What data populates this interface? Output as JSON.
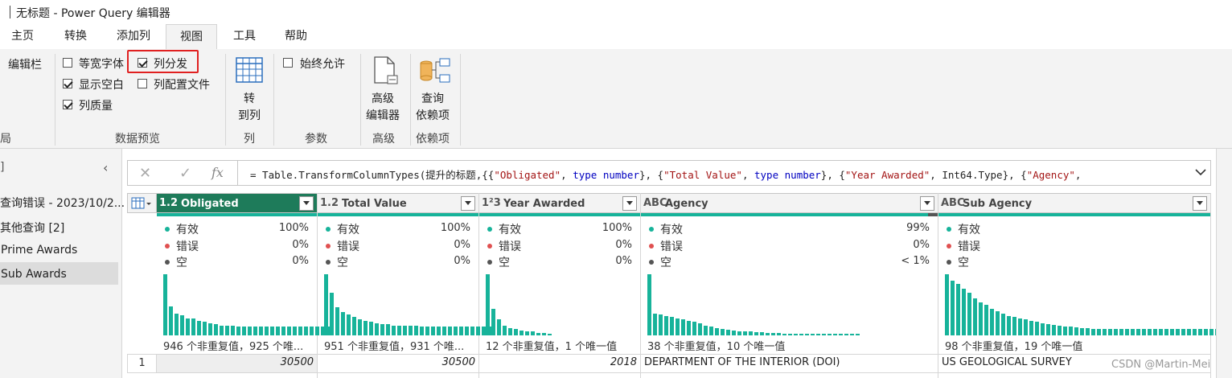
{
  "window": {
    "title": "无标题 - Power Query 编辑器"
  },
  "tabs": [
    "主页",
    "转换",
    "添加列",
    "视图",
    "工具",
    "帮助"
  ],
  "active_tab": "视图",
  "ribbon": {
    "layout_group": {
      "item": "编辑栏",
      "label": "局"
    },
    "preview_group": {
      "label": "数据预览",
      "items": [
        {
          "label": "等宽字体",
          "checked": false
        },
        {
          "label": "列分发",
          "checked": true
        },
        {
          "label": "显示空白",
          "checked": true
        },
        {
          "label": "列配置文件",
          "checked": false
        },
        {
          "label": "列质量",
          "checked": true
        }
      ]
    },
    "columns_group": {
      "label": "列",
      "button_line1": "转",
      "button_line2": "到列"
    },
    "params_group": {
      "label": "参数",
      "item": "始终允许",
      "checked": false
    },
    "advanced_group": {
      "label": "高级",
      "button_line1": "高级",
      "button_line2": "编辑器"
    },
    "deps_group": {
      "label": "依赖项",
      "button_line1": "查询",
      "button_line2": "依赖项"
    }
  },
  "left_panel": {
    "header": "]",
    "items": [
      "查询错误 - 2023/10/2...",
      "其他查询 [2]",
      "Prime Awards",
      "Sub Awards"
    ],
    "selected": "Sub Awards"
  },
  "formula": {
    "prefix": "= Table.TransformColumnTypes(提升的标题,{{",
    "s1": "\"Obligated\"",
    "t1": "type",
    "n1": "number",
    "s2": "\"Total Value\"",
    "t2": "type",
    "n2": "number",
    "s3": "\"Year Awarded\"",
    "t3": "Int64.Type",
    "s4": "\"Agency\"",
    "fx": "fx"
  },
  "quality_labels": {
    "valid": "有效",
    "error": "错误",
    "empty": "空"
  },
  "columns": [
    {
      "type": "1.2",
      "name": "Obligated",
      "valid": "100%",
      "error": "0%",
      "empty": "0%",
      "dist": "946 个非重复值，925 个唯...",
      "cell": "30500",
      "bars": [
        100,
        48,
        36,
        33,
        28,
        28,
        24,
        22,
        20,
        18,
        16,
        16,
        16,
        14,
        14,
        14,
        14,
        14,
        14,
        14,
        14,
        14,
        14,
        14,
        14,
        14,
        14,
        14,
        14,
        14
      ]
    },
    {
      "type": "1.2",
      "name": "Total Value",
      "valid": "100%",
      "error": "0%",
      "empty": "0%",
      "dist": "951 个非重复值，931 个唯...",
      "cell": "30500",
      "bars": [
        100,
        70,
        46,
        38,
        34,
        30,
        26,
        24,
        22,
        20,
        18,
        18,
        16,
        16,
        16,
        16,
        16,
        14,
        14,
        14,
        14,
        14,
        14,
        14,
        14,
        14,
        14,
        14,
        14,
        14
      ]
    },
    {
      "type": "1²3",
      "name": "Year Awarded",
      "valid": "100%",
      "error": "0%",
      "empty": "0%",
      "dist": "12 个非重复值，1 个唯一值",
      "cell": "2018",
      "bars": [
        100,
        44,
        26,
        16,
        12,
        10,
        8,
        6,
        6,
        4,
        4,
        2
      ]
    },
    {
      "type": "ABC",
      "name": "Agency",
      "valid": "99%",
      "error": "0%",
      "empty": "< 1%",
      "dist": "38 个非重复值，10 个唯一值",
      "cell": "DEPARTMENT OF THE INTERIOR (DOI)",
      "bars": [
        100,
        36,
        34,
        32,
        30,
        28,
        26,
        24,
        22,
        20,
        16,
        14,
        12,
        10,
        9,
        8,
        7,
        6,
        6,
        5,
        5,
        4,
        4,
        4,
        3,
        3,
        3,
        3,
        3,
        3,
        2,
        2,
        2,
        2,
        2,
        2,
        2,
        2
      ]
    },
    {
      "type": "ABC",
      "name": "Sub Agency",
      "valid": "",
      "error": "",
      "empty": "",
      "dist": "98 个非重复值，19 个唯一值",
      "cell": "US GEOLOGICAL SURVEY",
      "bars": [
        100,
        90,
        84,
        76,
        70,
        60,
        54,
        50,
        44,
        40,
        36,
        32,
        30,
        28,
        26,
        24,
        22,
        20,
        18,
        17,
        16,
        15,
        14,
        13,
        12,
        12,
        11,
        11,
        10,
        10,
        10,
        10,
        10,
        10,
        10,
        10,
        10,
        10,
        10,
        10,
        10,
        10,
        10,
        10,
        10,
        10,
        10,
        10,
        10,
        10,
        10,
        10
      ]
    }
  ],
  "row_number": "1",
  "watermark": "CSDN @Martin-Mei",
  "colors": {
    "accent": "#17b39a",
    "selected_header": "#1e7b5a",
    "error": "#e05050",
    "empty": "#555555"
  }
}
